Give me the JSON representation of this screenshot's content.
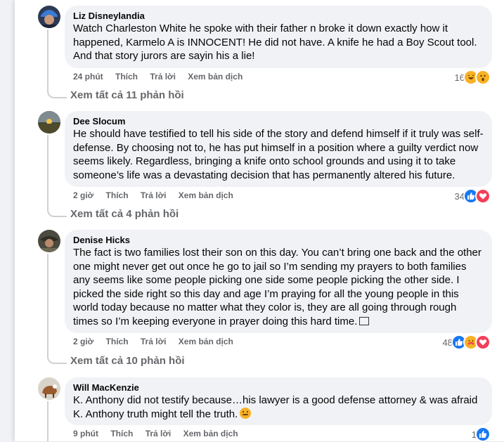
{
  "comments": [
    {
      "author": "Liz Disneylandia",
      "text": "Watch Charleston White he spoke with their father n broke it down exactly how it happened, Karmelo A is INNOCENT! He did not have. A knife he had a Boy Scout tool. And that story jurors are sayin his a lie!",
      "time": "24 phút",
      "like_label": "Thích",
      "reply_label": "Trả lời",
      "translate_label": "Xem bản dịch",
      "reaction_count": "16",
      "reactions": [
        "haha",
        "wow"
      ],
      "view_replies": "Xem tất cả 11 phản hồi"
    },
    {
      "author": "Dee Slocum",
      "text": "He should have testified to tell his side of the story and defend himself if it truly was self-defense. By choosing not to, he has put himself in a position where a guilty verdict now seems likely. Regardless, bringing a knife onto school grounds and using it to take someone’s life was a devastating decision that has permanently altered his future.",
      "time": "2 giờ",
      "like_label": "Thích",
      "reply_label": "Trả lời",
      "translate_label": "Xem bản dịch",
      "reaction_count": "34",
      "reactions": [
        "like",
        "love"
      ],
      "view_replies": "Xem tất cả 4 phản hồi"
    },
    {
      "author": "Denise Hicks",
      "text": "The fact is two families lost their son on this day. You can’t bring one back and the other one might never get out once he go to jail so I’m sending my prayers to both families any seems like some people picking one side some people picking the other side. I picked the side right so this day and age I’m praying for all the young people in this world today because no matter what they color is, they are all going through rough times so I’m keeping everyone in prayer doing this hard time.",
      "time": "2 giờ",
      "like_label": "Thích",
      "reply_label": "Trả lời",
      "translate_label": "Xem bản dịch",
      "reaction_count": "48",
      "reactions": [
        "like",
        "care",
        "love"
      ],
      "view_replies": "Xem tất cả 10 phản hồi"
    },
    {
      "author": "Will MacKenzie",
      "text_line1": "K. Anthony did not testify because…his lawyer is a good defense attorney & was afraid",
      "text_line2": "K. Anthony truth might tell the truth.",
      "time": "9 phút",
      "like_label": "Thích",
      "reply_label": "Trả lời",
      "translate_label": "Xem bản dịch",
      "reaction_count": "1",
      "reactions": [
        "like"
      ]
    }
  ],
  "colors": {
    "bubble": "#f0f2f5",
    "meta": "#65676b",
    "like": "#1877f2",
    "love": "#f33e58",
    "haha": "#f7b125"
  }
}
